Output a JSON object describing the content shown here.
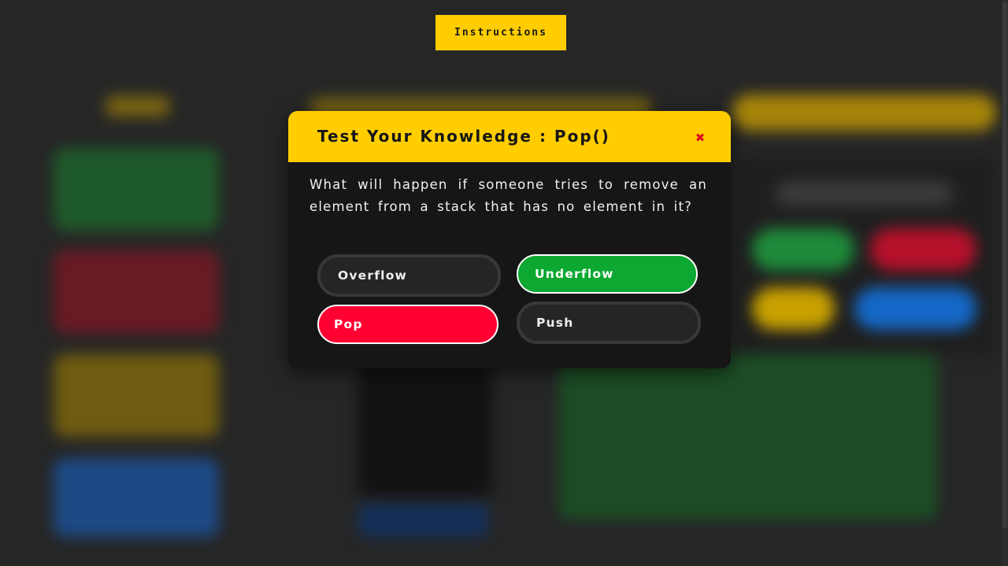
{
  "header": {
    "instructions_label": "Instructions"
  },
  "modal": {
    "title": "Test Your Knowledge : Pop()",
    "close_symbol": "✖",
    "question": "What will happen if someone tries to remove an element from a stack that has no element in it?",
    "options": [
      {
        "label": "Overflow",
        "state": "neutral"
      },
      {
        "label": "Underflow",
        "state": "correct"
      },
      {
        "label": "Pop",
        "state": "incorrect"
      },
      {
        "label": "Push",
        "state": "neutral"
      }
    ]
  },
  "colors": {
    "accent": "#ffcd00",
    "background": "#262626",
    "modal_background": "#161616",
    "correct": "#0ca831",
    "incorrect": "#ff0032",
    "neutral_option": "#252525",
    "close": "#e01020"
  }
}
